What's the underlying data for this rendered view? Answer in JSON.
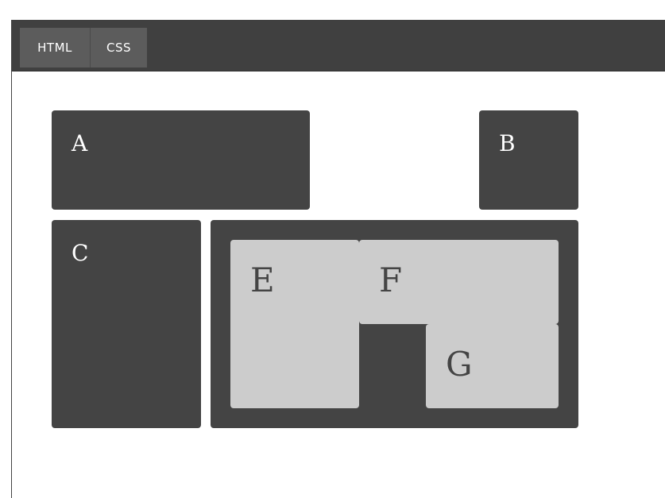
{
  "tabs": [
    {
      "label": "HTML"
    },
    {
      "label": "CSS"
    }
  ],
  "grid": {
    "a": "A",
    "b": "B",
    "c": "C"
  },
  "subgrid": {
    "e": "E",
    "f": "F",
    "g": "G"
  },
  "colors": {
    "toolbar": "#404040",
    "tab": "#5c5c5c",
    "box": "#444444",
    "inner_box": "#cccccc"
  }
}
